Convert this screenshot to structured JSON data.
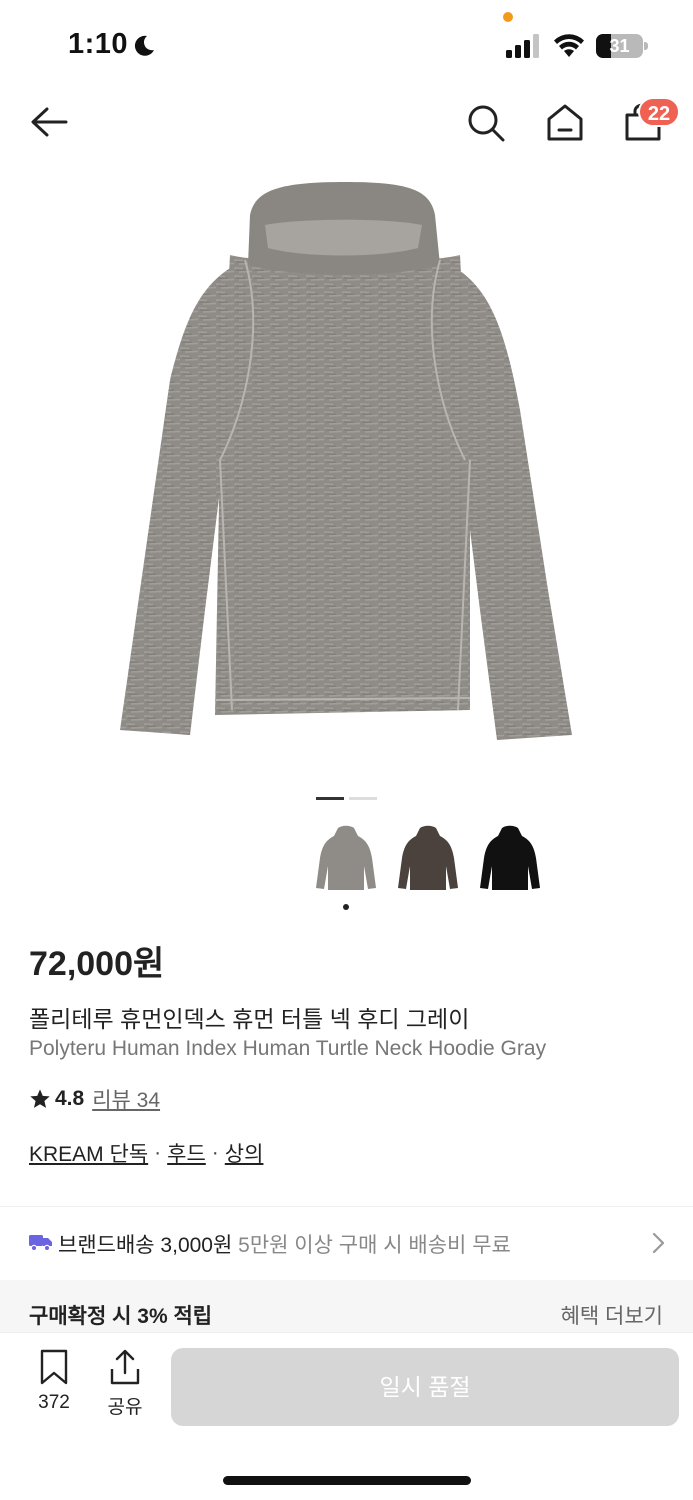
{
  "status_bar": {
    "time": "1:10",
    "battery": "31",
    "battery_level": 0.31,
    "icons": [
      "moon-icon",
      "signal-icon",
      "wifi-icon",
      "battery-icon"
    ],
    "indicator_color": "#f39a1b"
  },
  "nav": {
    "icons": [
      "back-arrow-icon",
      "search-icon",
      "home-icon",
      "cart-icon"
    ],
    "cart_badge": "22",
    "badge_color": "#ef6253"
  },
  "gallery": {
    "image": "gray-hoodie-photo",
    "page": 1,
    "page_count": 2,
    "color_options": [
      {
        "name": "gray",
        "color": "#8f8b86"
      },
      {
        "name": "brown",
        "color": "#4b423d"
      },
      {
        "name": "black",
        "color": "#111111"
      }
    ],
    "selected_option": 0
  },
  "product": {
    "price": "72,000원",
    "name_ko": "폴리테루 휴먼인덱스 휴먼 터틀 넥 후디 그레이",
    "name_en": "Polyteru Human Index Human Turtle Neck Hoodie Gray",
    "rating": "4.8",
    "review_label": "리뷰 34",
    "tags": [
      "KREAM 단독",
      "후드",
      "상의"
    ],
    "tag_separator": "·"
  },
  "shipping": {
    "main": "브랜드배송 3,000원",
    "sub": "5만원 이상 구매 시 배송비 무료",
    "icon_color": "#6b64e0"
  },
  "points": {
    "label": "구매확정 시 3% 적립",
    "more": "혜택 더보기"
  },
  "bottom_bar": {
    "bookmark_count": "372",
    "share_label": "공유",
    "action_label": "일시 품절"
  }
}
